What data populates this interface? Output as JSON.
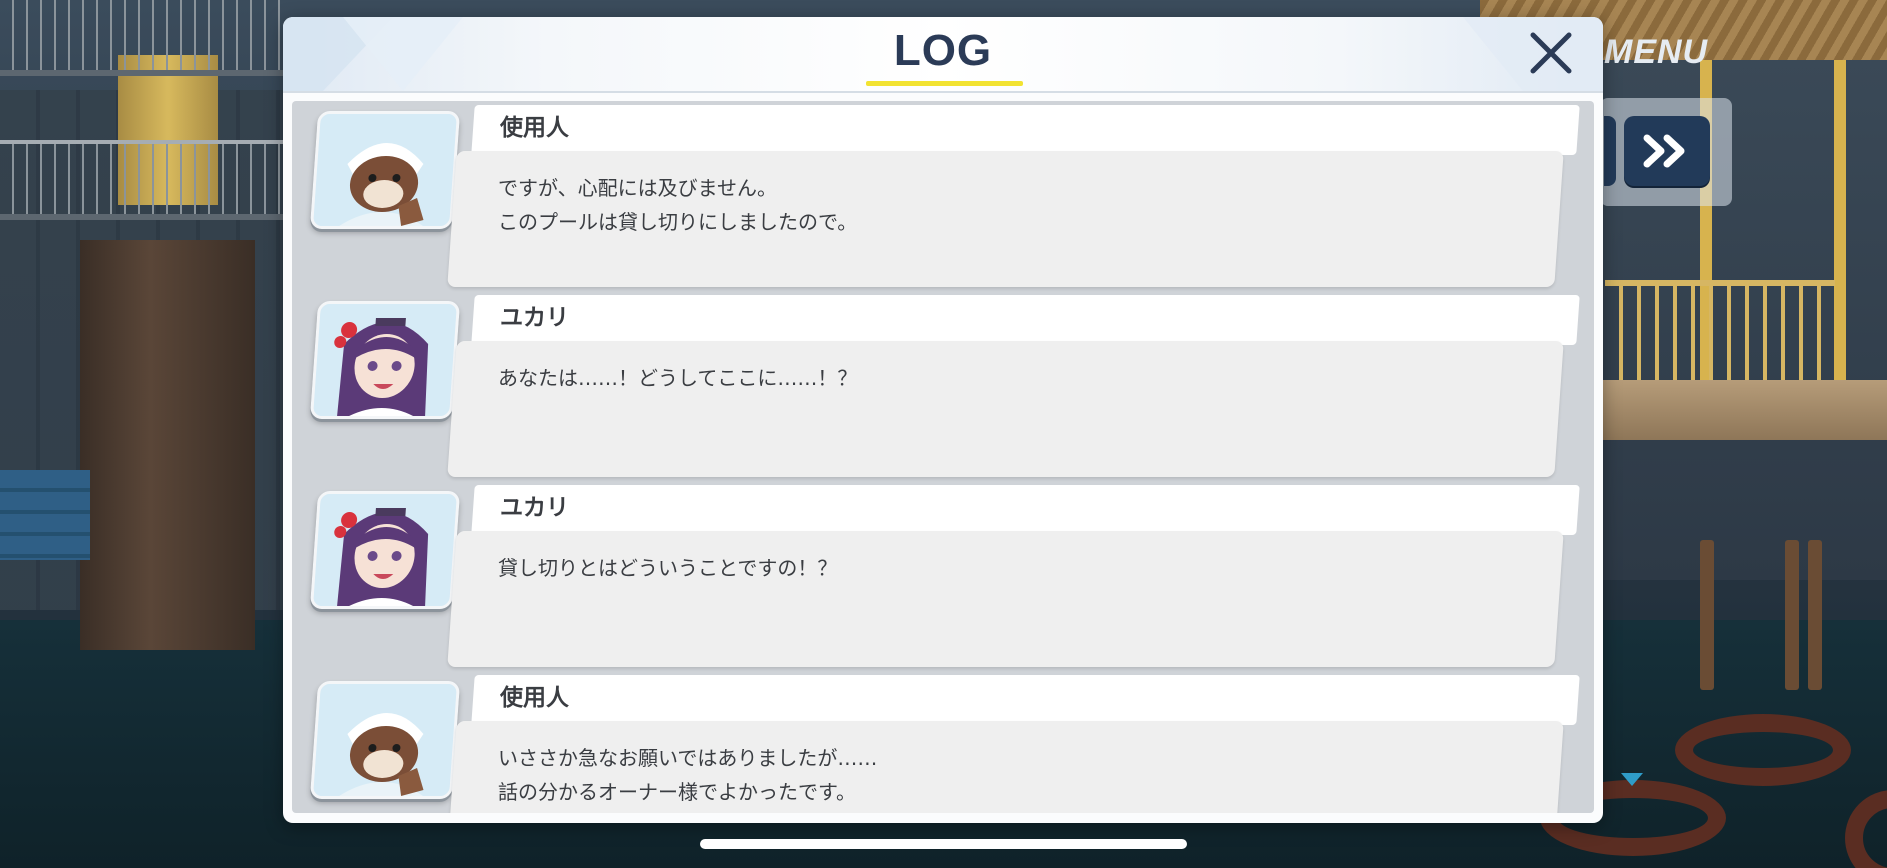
{
  "menu": {
    "label": "MENU",
    "fastforward_icon": "fast-forward-icon"
  },
  "log_window": {
    "title": "LOG",
    "close_icon": "close-icon",
    "accent_color": "#f2e332",
    "title_color": "#2b3b57"
  },
  "entries": [
    {
      "speaker": "使用人",
      "portrait_icon": "servant-avatar",
      "lines": "ですが、心配には及びません。\nこのプールは貸し切りにしましたので。"
    },
    {
      "speaker": "ユカリ",
      "portrait_icon": "yukari-avatar",
      "lines": "あなたは……！どうしてここに……！？"
    },
    {
      "speaker": "ユカリ",
      "portrait_icon": "yukari-avatar",
      "lines": "貸し切りとはどういうことですの！？"
    },
    {
      "speaker": "使用人",
      "portrait_icon": "servant-avatar",
      "lines": "いささか急なお願いではありましたが……\n話の分かるオーナー様でよかったです。"
    }
  ]
}
